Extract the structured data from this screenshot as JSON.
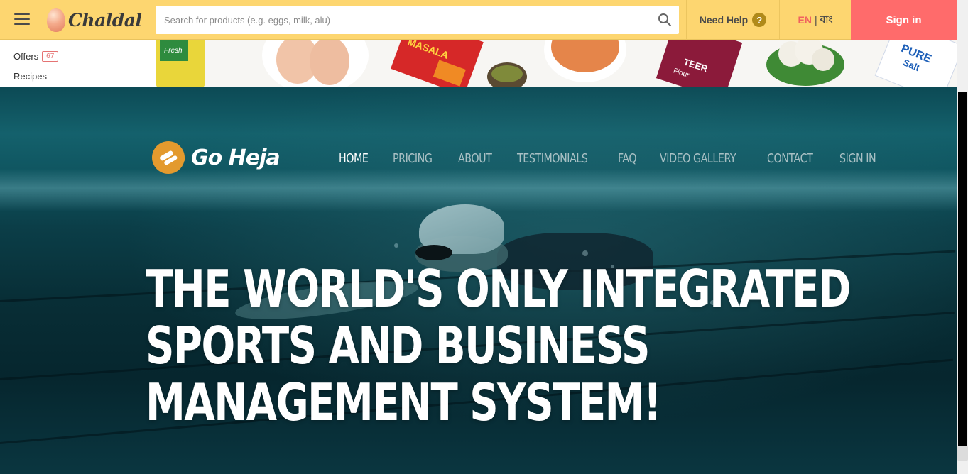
{
  "header": {
    "menu_icon": "hamburger-icon",
    "logo_text": "Chaldal",
    "search": {
      "placeholder": "Search for products (e.g. eggs, milk, alu)",
      "value": ""
    },
    "help_label": "Need Help",
    "help_icon_glyph": "?",
    "lang_en": "EN",
    "lang_separator": "|",
    "lang_bn": "বাং",
    "signin_label": "Sign in"
  },
  "sidebar": {
    "items": [
      {
        "label": "Offers",
        "badge": "67"
      },
      {
        "label": "Recipes"
      }
    ]
  },
  "banner": {
    "products": [
      {
        "name": "Fresh",
        "color": "#e9d63a"
      },
      {
        "name": "MASALA",
        "color": "#d62828"
      },
      {
        "name": "TEER Flour",
        "color": "#8b1a3a"
      },
      {
        "name": "PURE Salt",
        "color": "#1d5fb8"
      }
    ]
  },
  "hero": {
    "brand": "Go Heja",
    "brand_color": "#e39a2e",
    "nav": [
      {
        "label": "HOME",
        "active": true
      },
      {
        "label": "PRICING",
        "active": false
      },
      {
        "label": "ABOUT",
        "active": false
      },
      {
        "label": "TESTIMONIALS",
        "active": false
      },
      {
        "label": "FAQ",
        "active": false
      },
      {
        "label": "VIDEO GALLERY",
        "active": false
      },
      {
        "label": "CONTACT",
        "active": false
      },
      {
        "label": "SIGN IN",
        "active": false
      }
    ],
    "headline_lines": [
      "THE WORLD'S ONLY INTEGRATED",
      "SPORTS AND BUSINESS",
      "MANAGEMENT SYSTEM!"
    ]
  },
  "colors": {
    "header_bg": "#fdd670",
    "signin_bg": "#ff6b6b",
    "lang_active": "#f0625f",
    "hero_water": "#0b3e48"
  }
}
